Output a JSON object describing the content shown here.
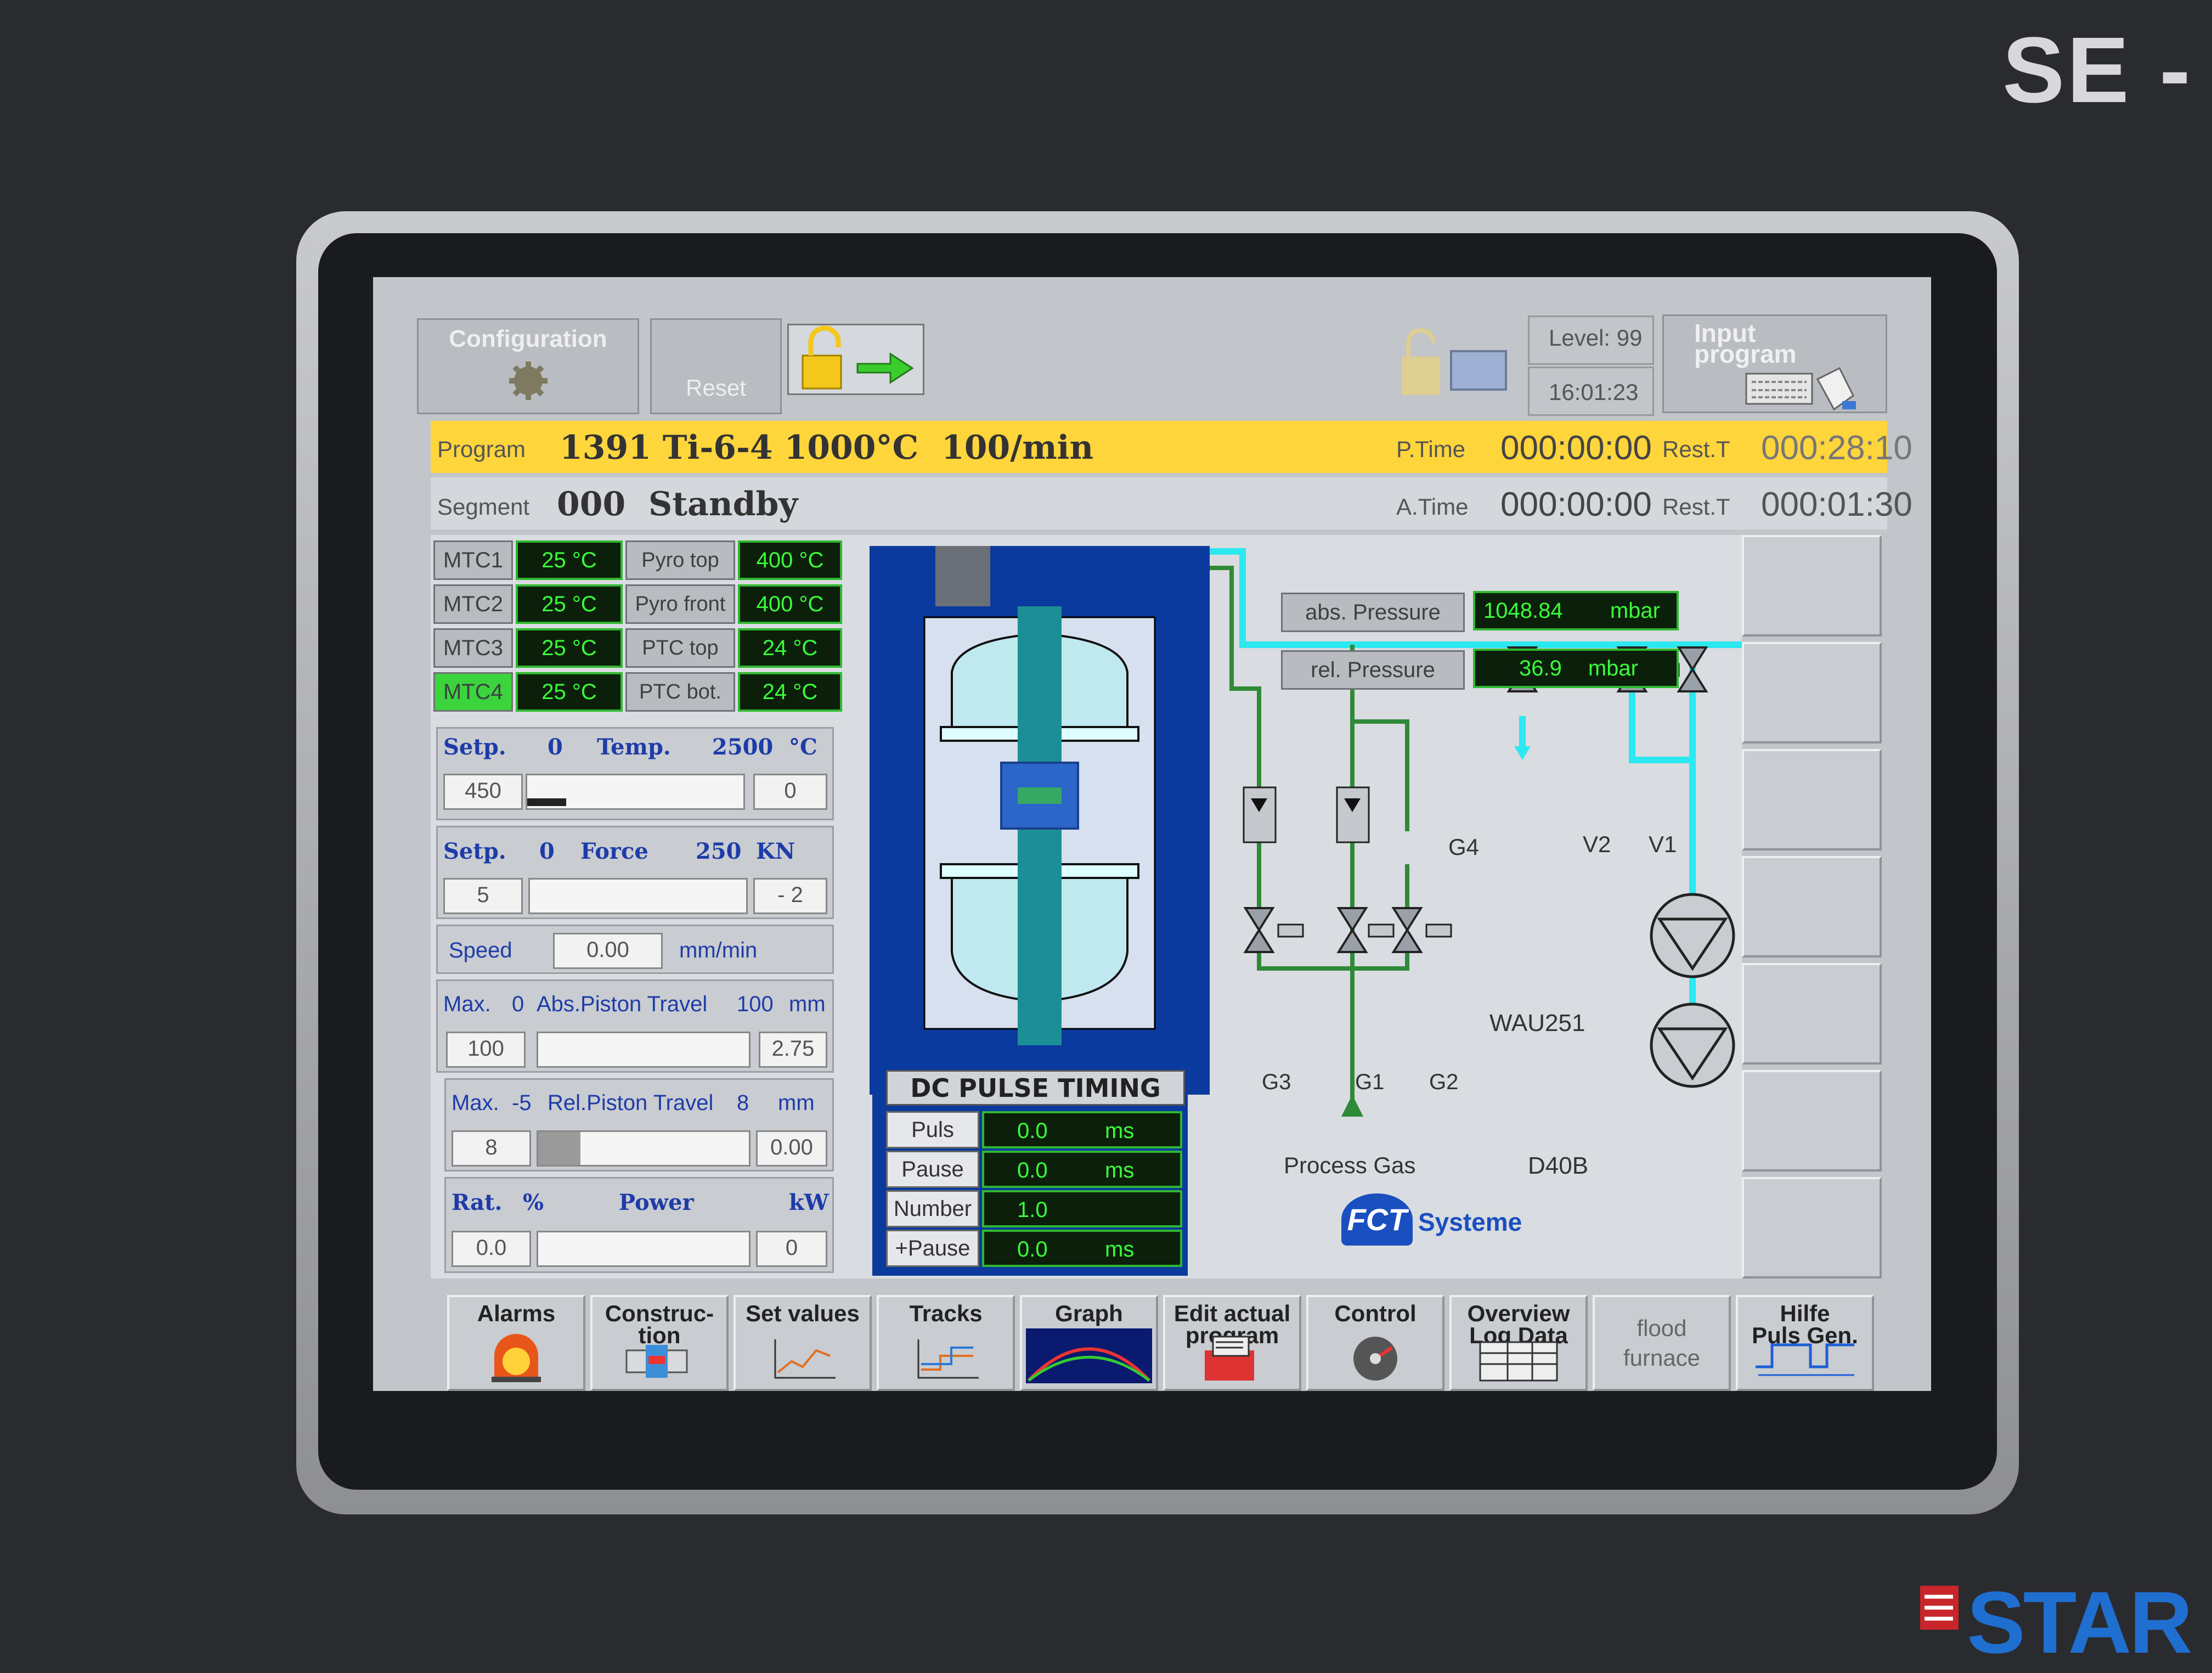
{
  "enclosure": {
    "model_text": "SE -",
    "brand_text": "STAR"
  },
  "toolbar": {
    "configuration": "Configuration",
    "reset": "Reset",
    "level": "Level: 99",
    "time": "16:01:23",
    "input_program": "Input program"
  },
  "program_bar": {
    "label": "Program",
    "value": "1391 Ti-6-4 1000°C  100/min",
    "ptime_label": "P.Time",
    "ptime": "000:00:00",
    "restt_label": "Rest.T",
    "restt": "000:28:10"
  },
  "segment_bar": {
    "label": "Segment",
    "value": "000  Standby",
    "atime_label": "A.Time",
    "atime": "000:00:00",
    "restt_label": "Rest.T",
    "restt": "000:01:30"
  },
  "temperatures": [
    {
      "name": "MTC1",
      "value": "25 °C",
      "sensor": "Pyro top",
      "sensor_value": "400 °C",
      "active": false
    },
    {
      "name": "MTC2",
      "value": "25 °C",
      "sensor": "Pyro front",
      "sensor_value": "400 °C",
      "active": false
    },
    {
      "name": "MTC3",
      "value": "25 °C",
      "sensor": "PTC top",
      "sensor_value": "24 °C",
      "active": false
    },
    {
      "name": "MTC4",
      "value": "25 °C",
      "sensor": "PTC bot.",
      "sensor_value": "24 °C",
      "active": true
    }
  ],
  "temp_setpoint": {
    "setp": "Setp.",
    "min": "0",
    "label": "Temp.",
    "max": "2500",
    "unit": "°C",
    "input": "450",
    "actual": "0",
    "level": 0.18
  },
  "force_setpoint": {
    "setp": "Setp.",
    "min": "0",
    "label": "Force",
    "max": "250",
    "unit": "KN",
    "input": "5",
    "actual": "- 2",
    "level": 0.0
  },
  "speed": {
    "label": "Speed",
    "value": "0.00",
    "unit": "mm/min"
  },
  "abs_piston": {
    "max": "Max.",
    "min": "0",
    "label": "Abs.Piston Travel",
    "max_value": "100",
    "unit": "mm",
    "input": "100",
    "actual": "2.75",
    "level": 0.0
  },
  "rel_piston": {
    "max": "Max.",
    "min": "-5",
    "label": "Rel.Piston Travel",
    "max_value": "8",
    "unit": "mm",
    "input": "8",
    "actual": "0.00",
    "level": 0.2
  },
  "power": {
    "rat": "Rat.",
    "pct": "%",
    "label": "Power",
    "unit": "kW",
    "input": "0.0",
    "actual": "0",
    "level": 0.0
  },
  "pressure": {
    "abs_label": "abs. Pressure",
    "abs_value": "1048.84",
    "abs_unit": "mbar",
    "rel_label": "rel. Pressure",
    "rel_value": "36.9",
    "rel_unit": "mbar"
  },
  "valves": {
    "g4": "G4",
    "v2": "V2",
    "v1": "V1",
    "g3": "G3",
    "g1": "G1",
    "g2": "G2"
  },
  "pumps": {
    "wau": "WAU251",
    "d40b": "D40B"
  },
  "process_gas": "Process Gas",
  "logo": {
    "mark": "FCT",
    "text": "Systeme"
  },
  "dc_pulse": {
    "title": "DC PULSE TIMING",
    "rows": [
      {
        "label": "Puls",
        "value": "0.0",
        "unit": "ms"
      },
      {
        "label": "Pause",
        "value": "0.0",
        "unit": "ms"
      },
      {
        "label": "Number",
        "value": "1.0",
        "unit": ""
      },
      {
        "label": "+Pause",
        "value": "0.0",
        "unit": "ms"
      }
    ]
  },
  "bottom_nav": [
    {
      "label": "Alarms",
      "icon": "alarm-bell-icon"
    },
    {
      "label": "Construc-\ntion",
      "icon": "construction-icon"
    },
    {
      "label": "Set values",
      "icon": "set-values-chart-icon"
    },
    {
      "label": "Tracks",
      "icon": "tracks-chart-icon"
    },
    {
      "label": "Graph",
      "icon": "graph-icon"
    },
    {
      "label": "Edit actual\nprogram",
      "icon": "edit-program-icon"
    },
    {
      "label": "Control",
      "icon": "control-gauge-icon"
    },
    {
      "label": "Overview\nLog Data",
      "icon": "log-data-icon"
    },
    {
      "label": "flood\nfurnace",
      "icon": ""
    },
    {
      "label": "Hilfe\nPuls Gen.",
      "icon": "pulse-generator-icon"
    }
  ]
}
